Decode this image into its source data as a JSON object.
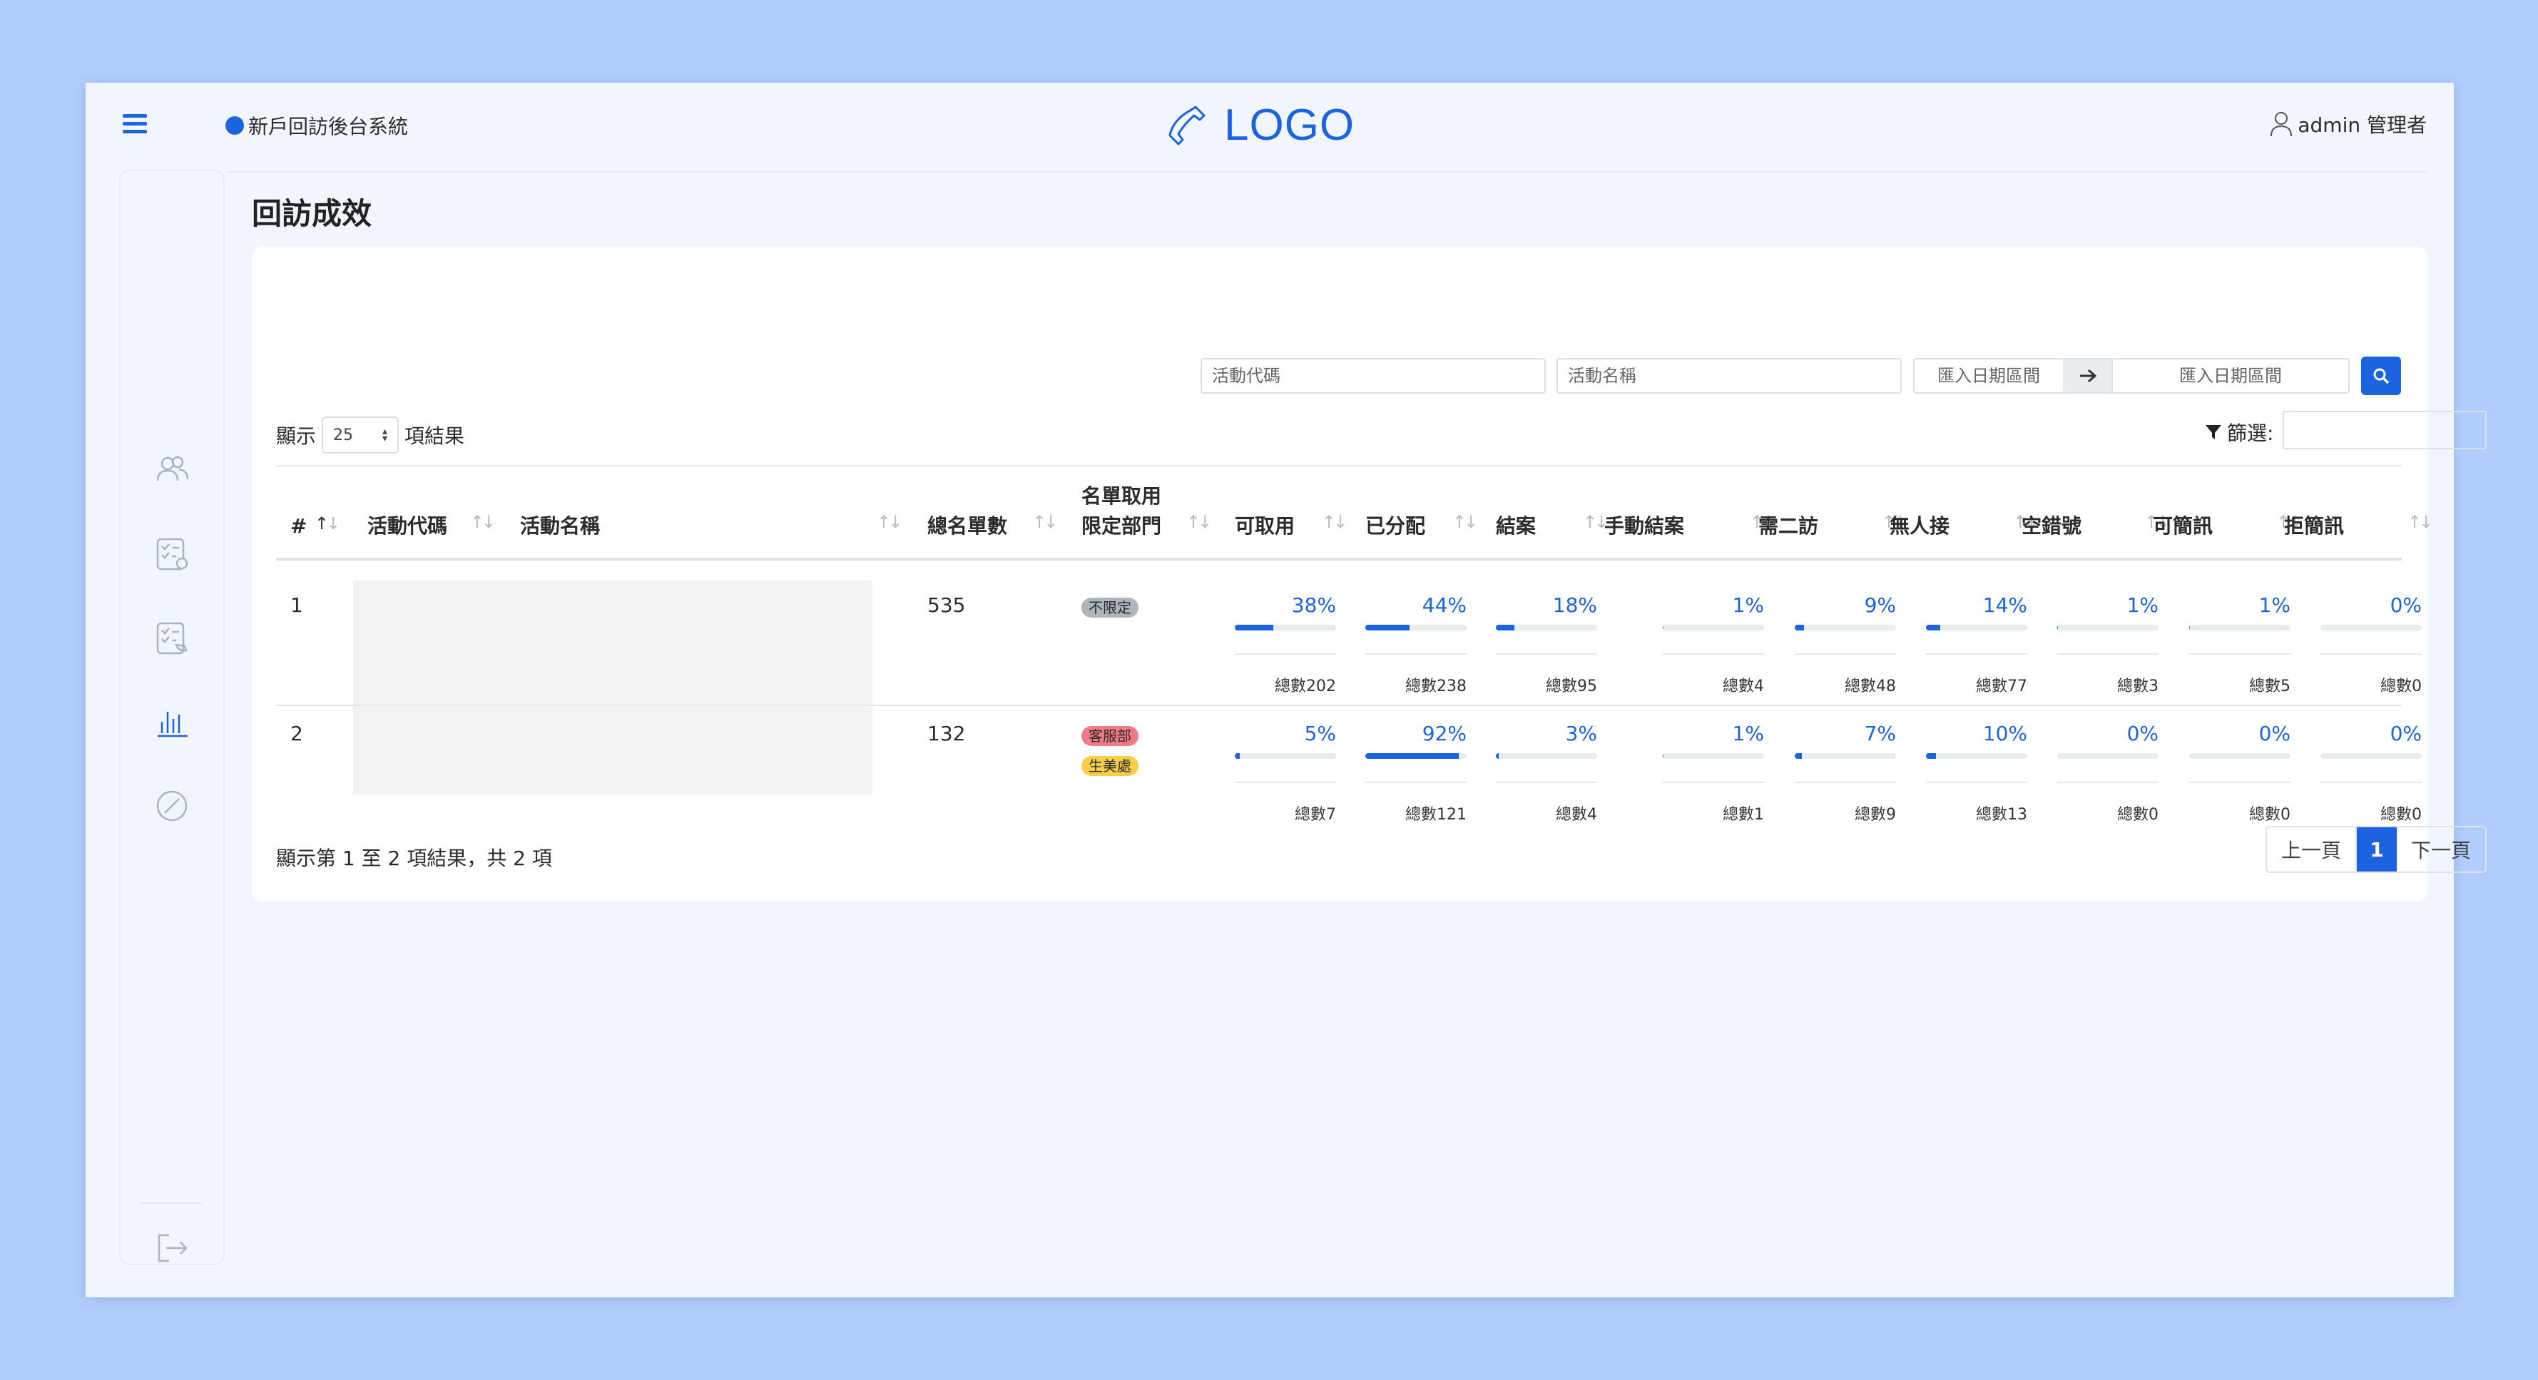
{
  "header": {
    "system_name": "新戶回訪後台系統",
    "logo_text": "LOGO",
    "user_label": "admin 管理者"
  },
  "sidebar": {
    "items": [
      {
        "icon": "users-icon"
      },
      {
        "icon": "checklist-settings-icon"
      },
      {
        "icon": "checklist-phone-icon"
      },
      {
        "icon": "bar-chart-icon",
        "active": true
      },
      {
        "icon": "blocked-icon"
      }
    ],
    "logout_icon": "logout-icon"
  },
  "page": {
    "title": "回訪成效"
  },
  "filters": {
    "activity_code_placeholder": "活動代碼",
    "activity_name_placeholder": "活動名稱",
    "date_start_placeholder": "匯入日期區間",
    "date_end_placeholder": "匯入日期區間",
    "show_prefix": "顯示",
    "page_size": "25",
    "show_suffix": "項結果",
    "filter_label": "篩選:"
  },
  "table": {
    "headers": {
      "index": "#",
      "activity_code": "活動代碼",
      "activity_name": "活動名稱",
      "total": "總名單數",
      "dept_line1": "名單取用",
      "dept_line2": "限定部門",
      "available": "可取用",
      "assigned": "已分配",
      "closed": "結案",
      "manual_closed": "手動結案",
      "second_visit": "需二訪",
      "no_answer": "無人接",
      "empty_number": "空錯號",
      "sms_ok": "可簡訊",
      "sms_refuse": "拒簡訊"
    },
    "rows": [
      {
        "index": "1",
        "total": "535",
        "depts": [
          {
            "label": "不限定",
            "color": "#adb5bd"
          }
        ],
        "stats": [
          {
            "pct": "38%",
            "value": 38,
            "total": "總數202"
          },
          {
            "pct": "44%",
            "value": 44,
            "total": "總數238"
          },
          {
            "pct": "18%",
            "value": 18,
            "total": "總數95"
          },
          {
            "pct": "1%",
            "value": 1,
            "total": "總數4"
          },
          {
            "pct": "9%",
            "value": 9,
            "total": "總數48"
          },
          {
            "pct": "14%",
            "value": 14,
            "total": "總數77"
          },
          {
            "pct": "1%",
            "value": 1,
            "total": "總數3"
          },
          {
            "pct": "1%",
            "value": 1,
            "total": "總數5"
          },
          {
            "pct": "0%",
            "value": 0,
            "total": "總數0"
          }
        ]
      },
      {
        "index": "2",
        "total": "132",
        "depts": [
          {
            "label": "客服部",
            "color": "#f07a86"
          },
          {
            "label": "生美處",
            "color": "#f6cf4a"
          }
        ],
        "stats": [
          {
            "pct": "5%",
            "value": 5,
            "total": "總數7"
          },
          {
            "pct": "92%",
            "value": 92,
            "total": "總數121"
          },
          {
            "pct": "3%",
            "value": 3,
            "total": "總數4"
          },
          {
            "pct": "1%",
            "value": 1,
            "total": "總數1"
          },
          {
            "pct": "7%",
            "value": 7,
            "total": "總數9"
          },
          {
            "pct": "10%",
            "value": 10,
            "total": "總數13"
          },
          {
            "pct": "0%",
            "value": 0,
            "total": "總數0"
          },
          {
            "pct": "0%",
            "value": 0,
            "total": "總數0"
          },
          {
            "pct": "0%",
            "value": 0,
            "total": "總數0"
          }
        ]
      }
    ]
  },
  "footer": {
    "info": "顯示第 1 至 2 項結果，共 2 項",
    "prev": "上一頁",
    "current_page": "1",
    "next": "下一頁"
  },
  "colors": {
    "accent": "#1c63e0",
    "background": "#b1cdfd",
    "frame": "#f1f5fc"
  }
}
